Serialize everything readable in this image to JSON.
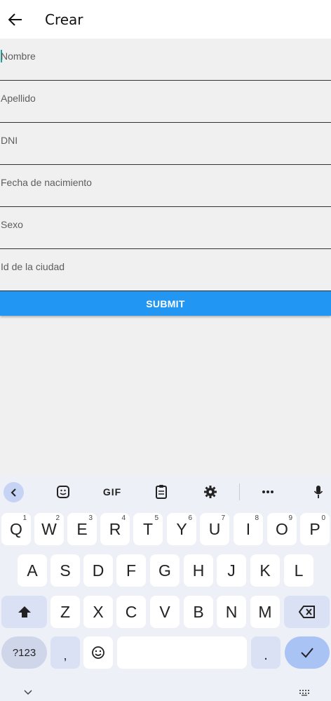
{
  "appbar": {
    "title": "Crear",
    "back_icon": "arrow-left-icon"
  },
  "form": {
    "fields": [
      {
        "placeholder": "Nombre"
      },
      {
        "placeholder": "Apellido"
      },
      {
        "placeholder": "DNI"
      },
      {
        "placeholder": "Fecha de nacimiento"
      },
      {
        "placeholder": "Sexo"
      },
      {
        "placeholder": "Id de la ciudad"
      }
    ],
    "submit_label": "SUBMIT"
  },
  "keyboard": {
    "toolbar": {
      "collapse_icon": "chevron-left-icon",
      "sticker_icon": "sticker-icon",
      "gif_label": "GIF",
      "clipboard_icon": "clipboard-icon",
      "settings_icon": "gear-icon",
      "more_icon": "more-icon",
      "mic_icon": "microphone-icon"
    },
    "row1": [
      {
        "label": "Q",
        "hint": "1"
      },
      {
        "label": "W",
        "hint": "2"
      },
      {
        "label": "E",
        "hint": "3"
      },
      {
        "label": "R",
        "hint": "4"
      },
      {
        "label": "T",
        "hint": "5"
      },
      {
        "label": "Y",
        "hint": "6"
      },
      {
        "label": "U",
        "hint": "7"
      },
      {
        "label": "I",
        "hint": "8"
      },
      {
        "label": "O",
        "hint": "9"
      },
      {
        "label": "P",
        "hint": "0"
      }
    ],
    "row2": [
      "A",
      "S",
      "D",
      "F",
      "G",
      "H",
      "J",
      "K",
      "L"
    ],
    "row3": [
      "Z",
      "X",
      "C",
      "V",
      "B",
      "N",
      "M"
    ],
    "symbols_label": "?123",
    "comma_label": ",",
    "period_label": ".",
    "accent_color": "#2196f3"
  }
}
